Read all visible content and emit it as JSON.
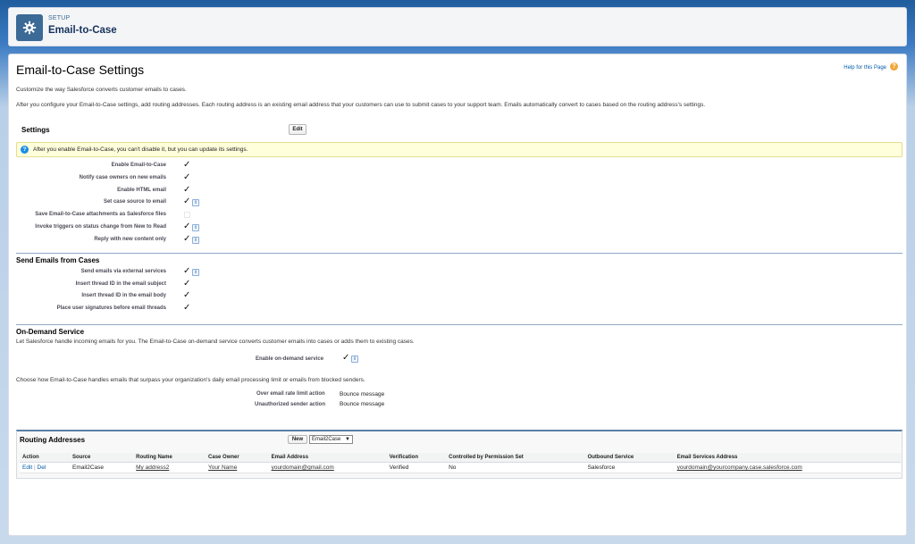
{
  "header": {
    "setup_label": "SETUP",
    "title": "Email-to-Case"
  },
  "page": {
    "title": "Email-to-Case Settings",
    "help_link": "Help for this Page",
    "intro1": "Customize the way Salesforce converts customer emails to cases.",
    "intro2": "After you configure your Email-to-Case settings, add routing addresses. Each routing address is an existing email address that your customers can use to submit cases to your support team. Emails automatically convert to cases based on the routing address's settings."
  },
  "settings": {
    "heading": "Settings",
    "edit_label": "Edit",
    "banner": "After you enable Email-to-Case, you can't disable it, but you can update its settings.",
    "rows": [
      {
        "label": "Enable Email-to-Case",
        "checked": true,
        "info": false
      },
      {
        "label": "Notify case owners on new emails",
        "checked": true,
        "info": false
      },
      {
        "label": "Enable HTML email",
        "checked": true,
        "info": false
      },
      {
        "label": "Set case source to email",
        "checked": true,
        "info": true
      },
      {
        "label": "Save Email-to-Case attachments as Salesforce files",
        "checked": false,
        "info": false
      },
      {
        "label": "Invoke triggers on status change from New to Read",
        "checked": true,
        "info": true
      },
      {
        "label": "Reply with new content only",
        "checked": true,
        "info": true
      }
    ]
  },
  "send_emails": {
    "heading": "Send Emails from Cases",
    "rows": [
      {
        "label": "Send emails via external services",
        "checked": true,
        "info": true
      },
      {
        "label": "Insert thread ID in the email subject",
        "checked": true,
        "info": false
      },
      {
        "label": "Insert thread ID in the email body",
        "checked": true,
        "info": false
      },
      {
        "label": "Place user signatures before email threads",
        "checked": true,
        "info": false
      }
    ]
  },
  "on_demand": {
    "heading": "On-Demand Service",
    "description": "Let Salesforce handle incoming emails for you. The Email-to-Case on-demand service converts customer emails into cases or adds them to existing cases.",
    "enable_label": "Enable on-demand service",
    "limit_description": "Choose how Email-to-Case handles emails that surpass your organization's daily email processing limit or emails from blocked senders.",
    "over_limit_label": "Over email rate limit action",
    "over_limit_value": "Bounce message",
    "unauthorized_label": "Unauthorized sender action",
    "unauthorized_value": "Bounce message"
  },
  "routing": {
    "heading": "Routing Addresses",
    "new_label": "New",
    "select_value": "Email2Case",
    "columns": [
      "Action",
      "Source",
      "Routing Name",
      "Case Owner",
      "Email Address",
      "Verification",
      "Controlled by Permission Set",
      "Outbound Service",
      "Email Services Address"
    ],
    "row": {
      "edit": "Edit",
      "sep": "|",
      "del": "Del",
      "source": "Email2Case",
      "routing_name": "My address2",
      "case_owner": "Your Name",
      "email": "yourdomain@gmail.com",
      "verification": "Verified",
      "permission_set": "No",
      "outbound": "Salesforce",
      "services_address": "yourdomain@yourcompany.case.salesforce.com"
    }
  }
}
